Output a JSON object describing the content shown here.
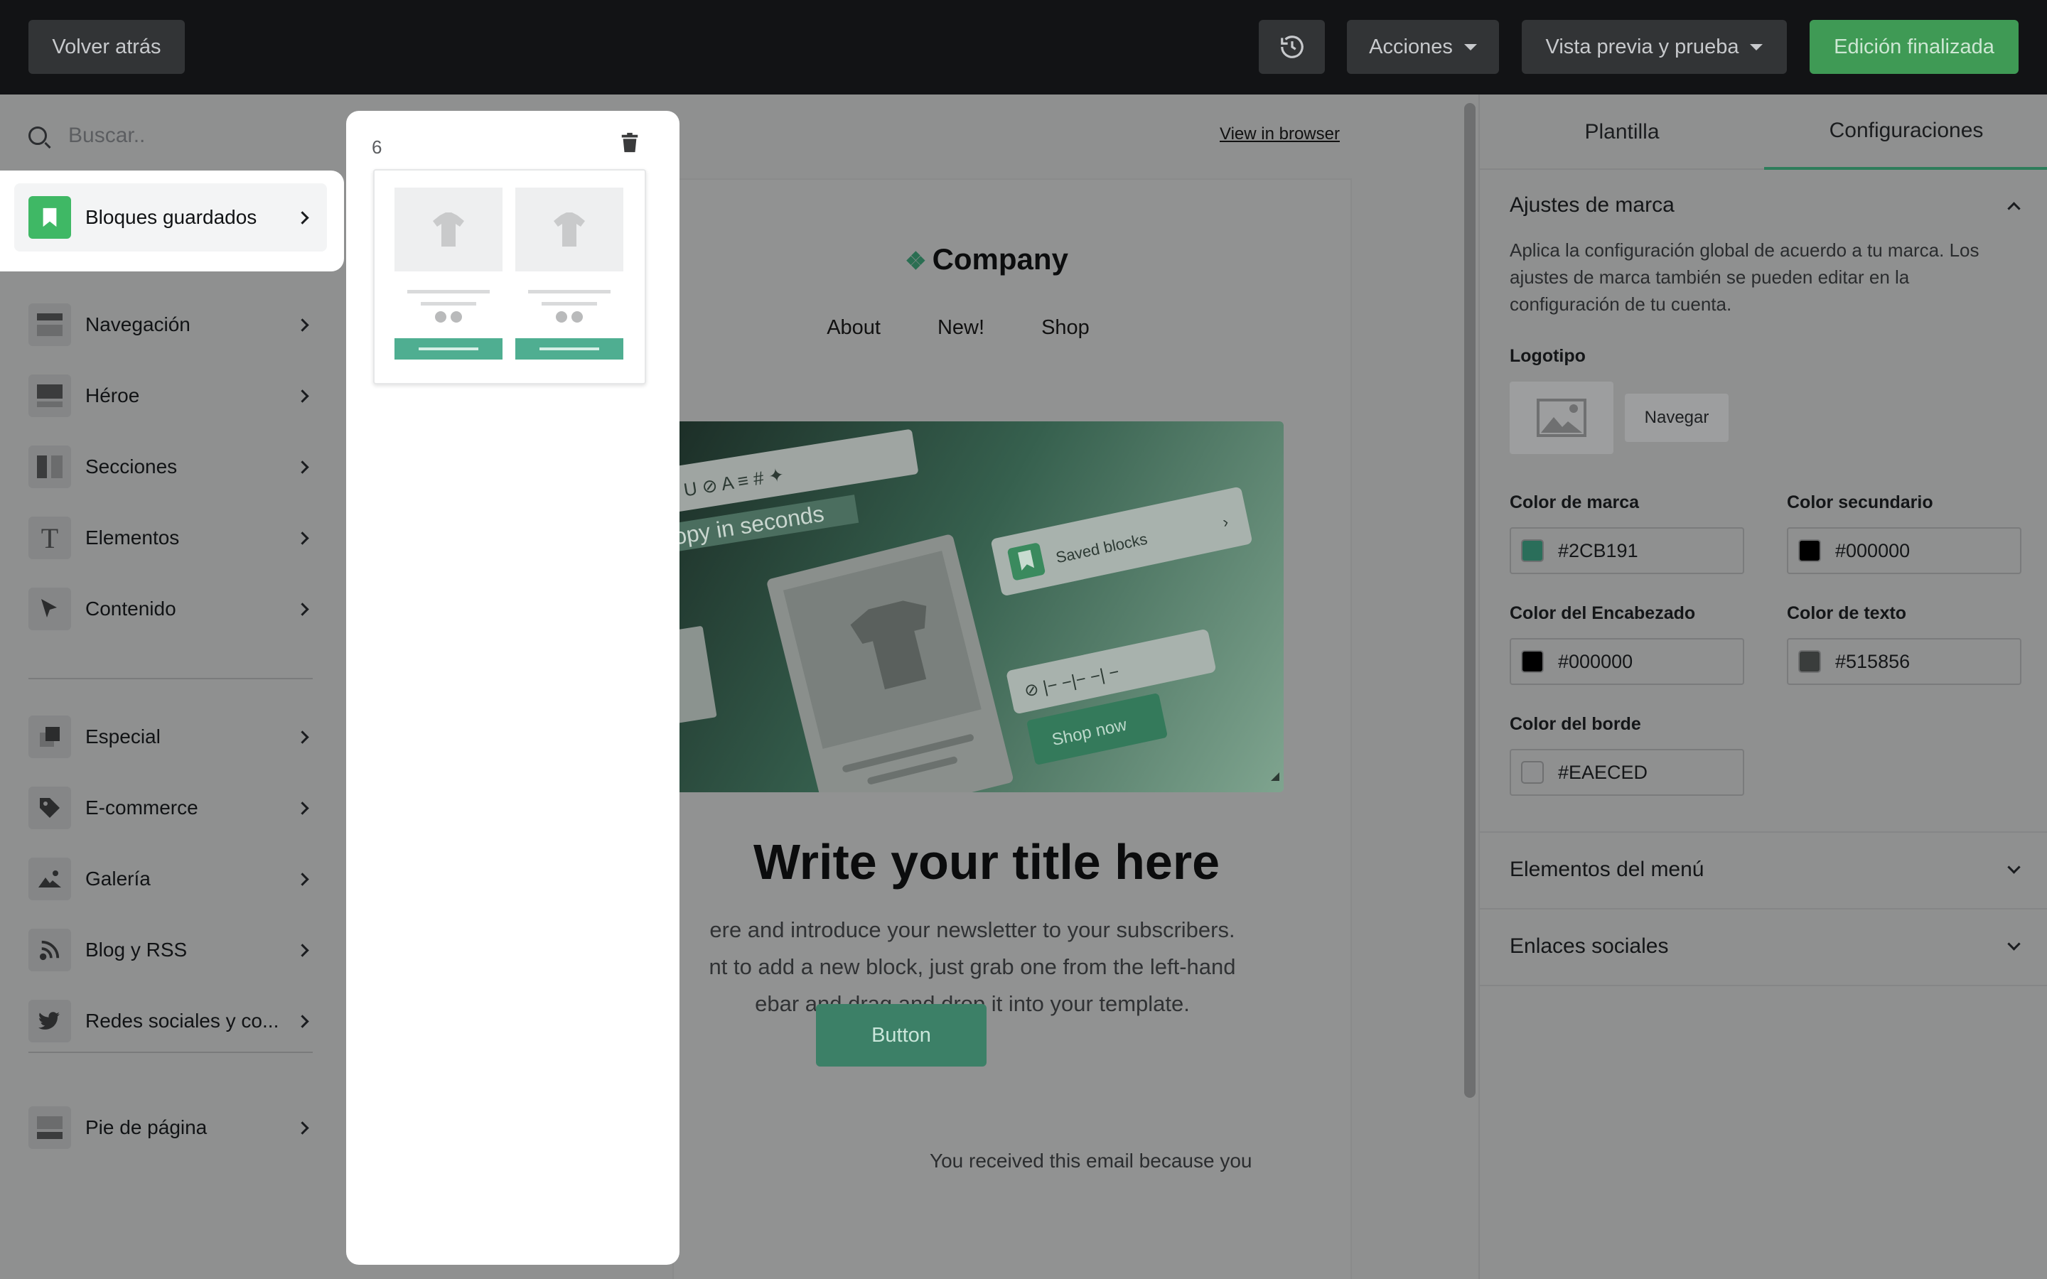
{
  "topbar": {
    "back_label": "Volver atrás",
    "actions_label": "Acciones",
    "preview_label": "Vista previa y prueba",
    "done_label": "Edición finalizada",
    "history_icon": "history-icon"
  },
  "sidebar": {
    "search_placeholder": "Buscar..",
    "saved_label": "Bloques guardados",
    "items": [
      {
        "label": "Navegación",
        "icon": "navigation-icon"
      },
      {
        "label": "Héroe",
        "icon": "hero-icon"
      },
      {
        "label": "Secciones",
        "icon": "sections-icon"
      },
      {
        "label": "Elementos",
        "icon": "text-icon"
      },
      {
        "label": "Contenido",
        "icon": "cursor-icon"
      },
      {
        "label": "Especial",
        "icon": "special-icon"
      },
      {
        "label": "E-commerce",
        "icon": "tag-icon"
      },
      {
        "label": "Galería",
        "icon": "image-icon"
      },
      {
        "label": "Blog y RSS",
        "icon": "rss-icon"
      },
      {
        "label": "Redes sociales y co...",
        "icon": "twitter-icon"
      },
      {
        "label": "Pie de página",
        "icon": "footer-icon"
      }
    ]
  },
  "flyout": {
    "count": "6"
  },
  "canvas": {
    "view_in_browser": "View in browser",
    "company": "Company",
    "nav_links": [
      "About",
      "New!",
      "Shop"
    ],
    "hero": {
      "toolbar_text": "opy in seconds",
      "saved_blocks": "Saved blocks",
      "shop_now": "Shop now"
    },
    "title": "Write your title here",
    "body_lines": [
      "ere and introduce your newsletter to your subscribers.",
      "nt to add a new block, just grab one from the left-hand",
      "ebar and drag and drop it into your template."
    ],
    "button_label": "Button",
    "footer_text": "You received this email because you"
  },
  "rpanel": {
    "tab_template": "Plantilla",
    "tab_settings": "Configuraciones",
    "brand_section": "Ajustes de marca",
    "brand_desc": "Aplica la configuración global de acuerdo a tu marca. Los ajustes de marca también se pueden editar en la configuración de tu cuenta.",
    "logo_label": "Logotipo",
    "browse_label": "Navegar",
    "brand_color_label": "Color de marca",
    "brand_color": "#2CB191",
    "secondary_color_label": "Color secundario",
    "secondary_color": "#000000",
    "heading_color_label": "Color del Encabezado",
    "heading_color": "#000000",
    "text_color_label": "Color de texto",
    "text_color": "#515856",
    "border_color_label": "Color del borde",
    "border_color": "#EAECED",
    "menu_section": "Elementos del menú",
    "social_section": "Enlaces sociales"
  }
}
